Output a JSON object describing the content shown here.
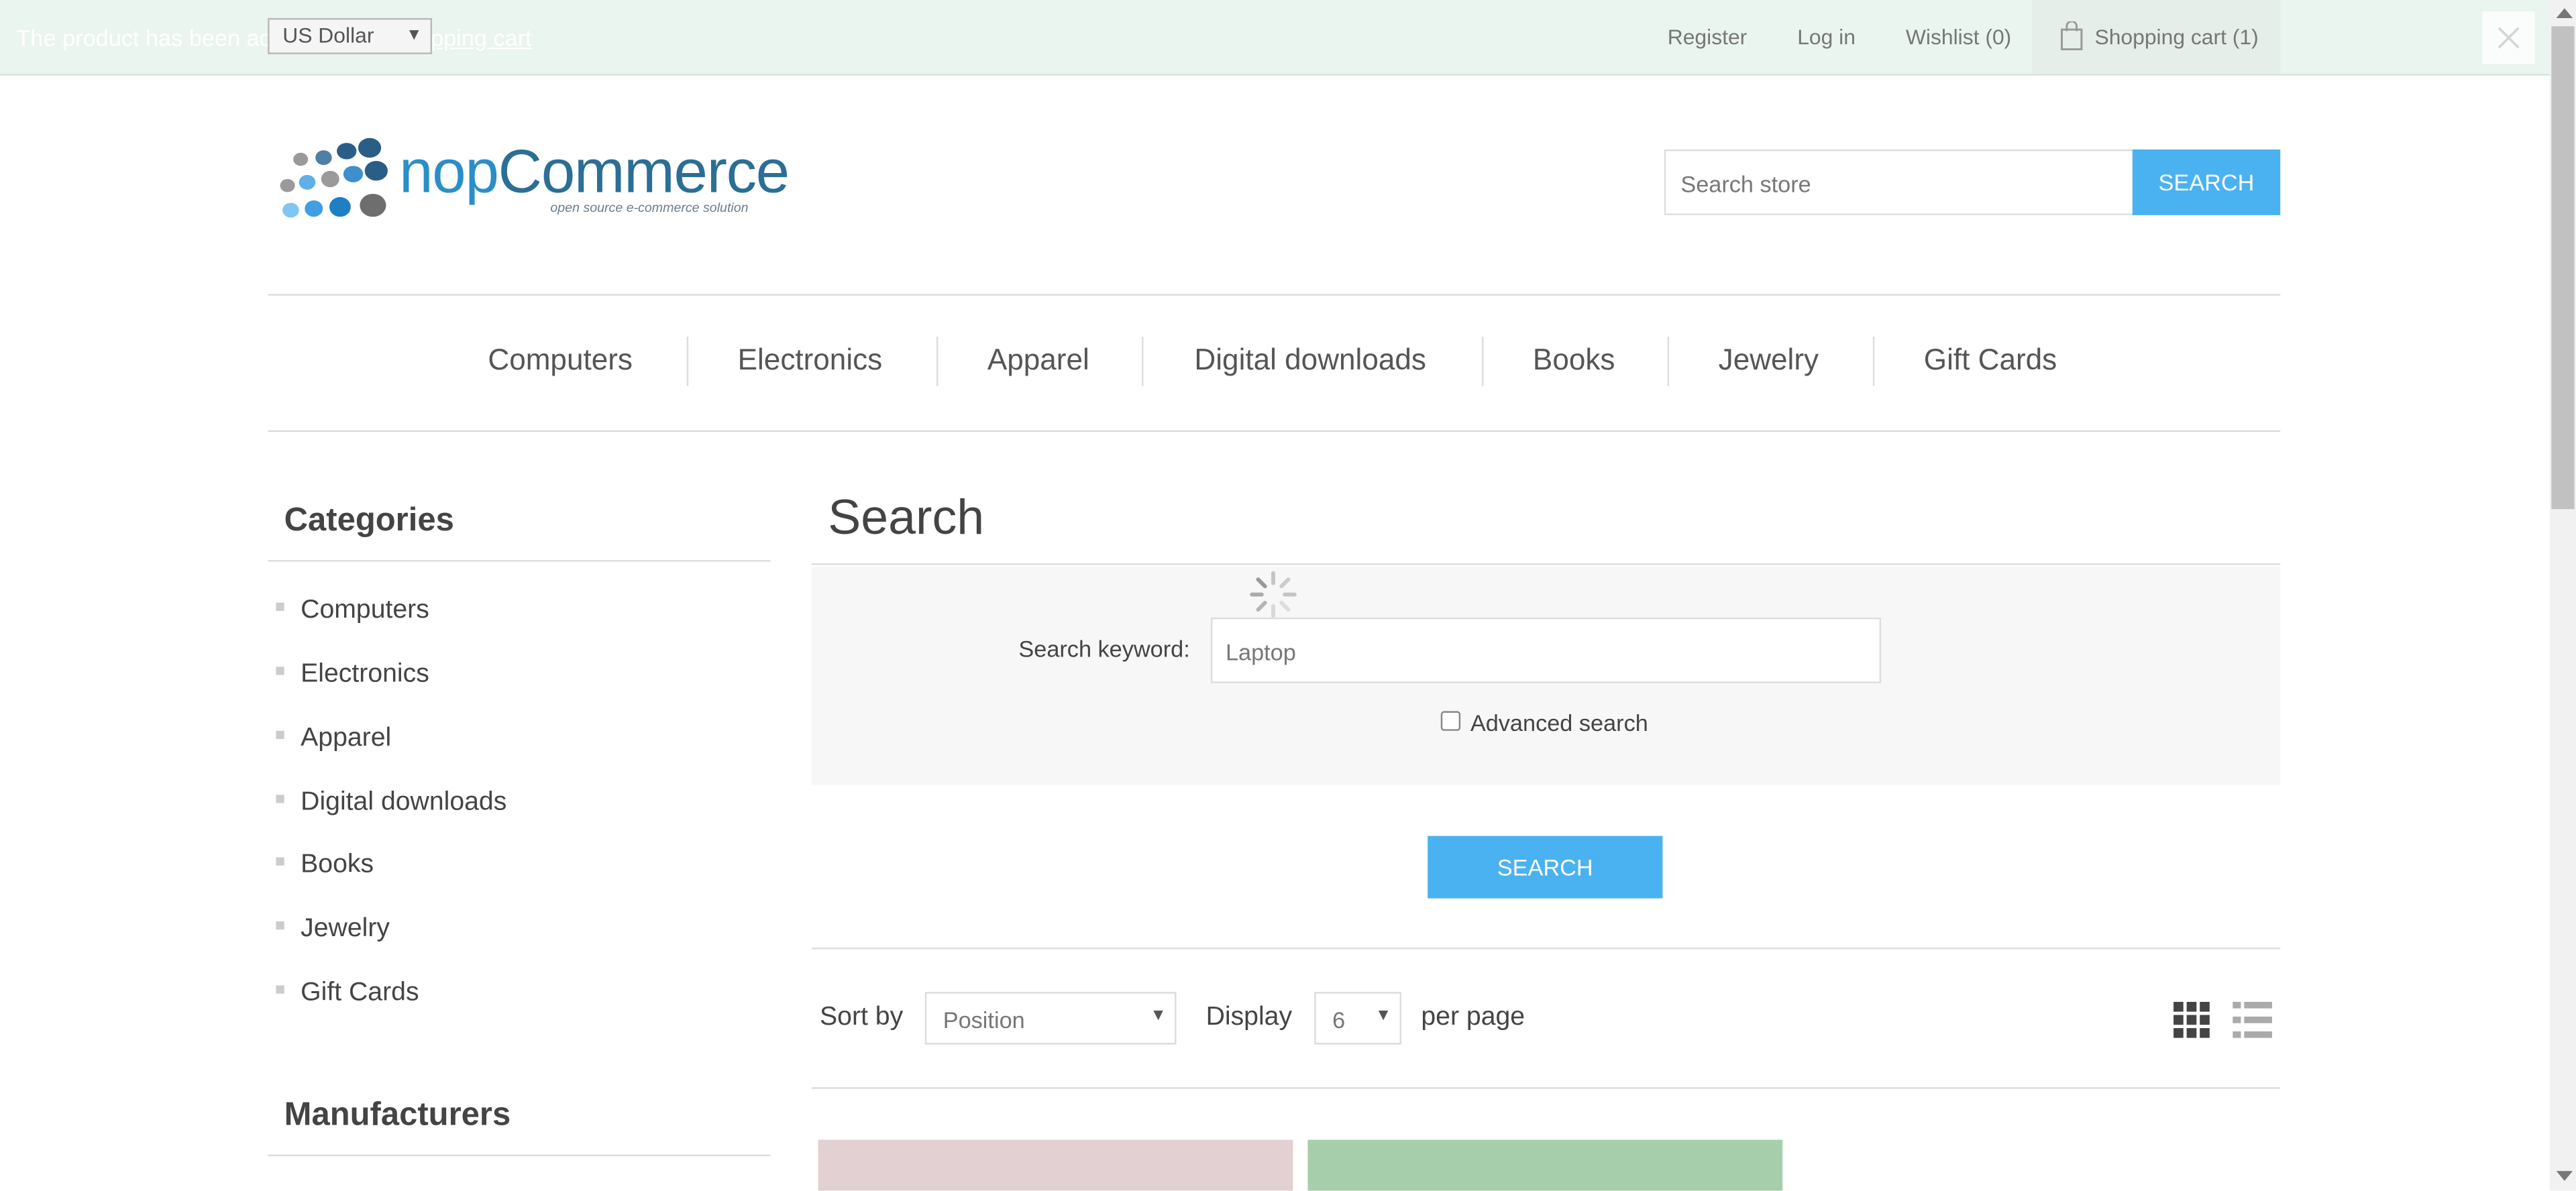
{
  "notification": {
    "text_before": "The product has been added to your ",
    "link_text": "shopping cart"
  },
  "header": {
    "currency": "US Dollar",
    "links": {
      "register": "Register",
      "login": "Log in",
      "wishlist": "Wishlist (0)",
      "cart": "Shopping cart (1)"
    }
  },
  "logo": {
    "word_part1": "nop",
    "word_part2": "Commerce",
    "tagline": "open source e-commerce solution"
  },
  "store_search": {
    "placeholder": "Search store",
    "button": "SEARCH"
  },
  "top_menu": [
    "Computers",
    "Electronics",
    "Apparel",
    "Digital downloads",
    "Books",
    "Jewelry",
    "Gift Cards"
  ],
  "sidebar": {
    "categories_title": "Categories",
    "categories": [
      "Computers",
      "Electronics",
      "Apparel",
      "Digital downloads",
      "Books",
      "Jewelry",
      "Gift Cards"
    ],
    "manufacturers_title": "Manufacturers"
  },
  "search_page": {
    "title": "Search",
    "keyword_label": "Search keyword:",
    "keyword_value": "Laptop",
    "advanced_label": "Advanced search",
    "advanced_checked": false,
    "button": "SEARCH"
  },
  "controls": {
    "sort_label": "Sort by",
    "sort_value": "Position",
    "display_label": "Display",
    "display_value": "6",
    "per_page_label": "per page"
  },
  "colors": {
    "accent": "#4ab2f1",
    "notification_bg": "#eaf5ef",
    "tile_1": "#e3d0d2",
    "tile_2": "#a7ceab"
  }
}
